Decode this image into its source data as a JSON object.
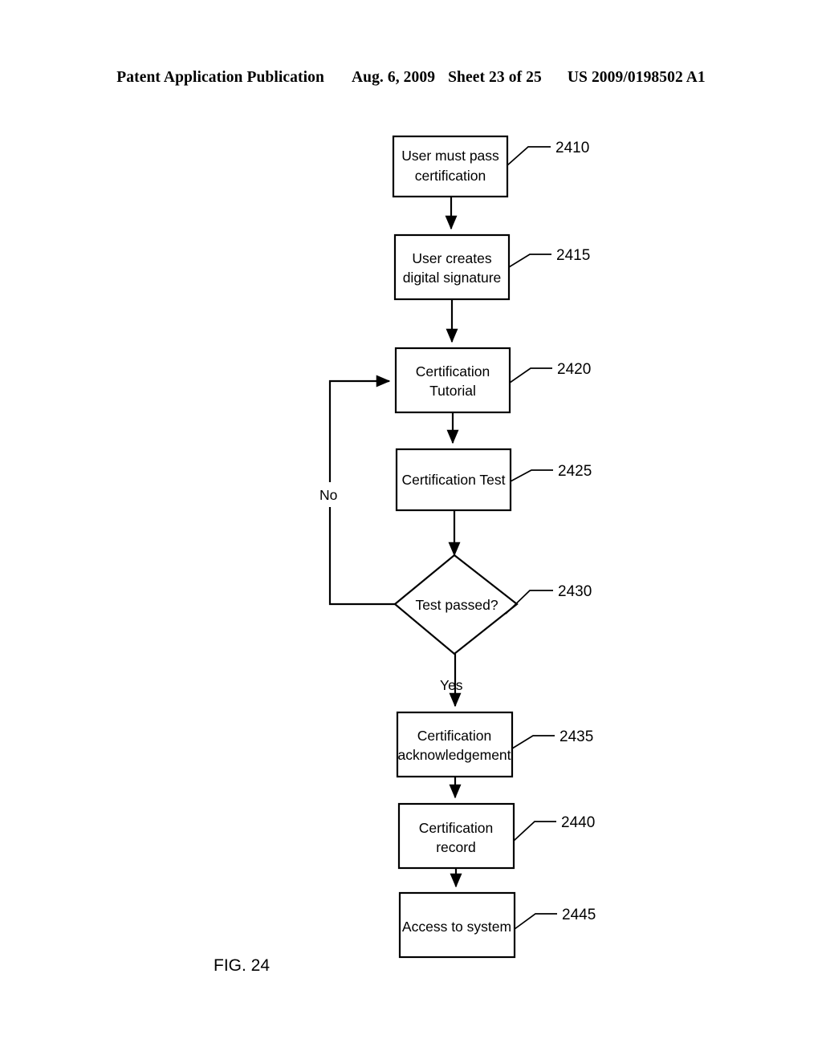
{
  "header": {
    "publication": "Patent Application Publication",
    "date": "Aug. 6, 2009",
    "sheet": "Sheet 23 of 25",
    "patent_number": "US 2009/0198502 A1"
  },
  "figure": {
    "caption": "FIG. 24",
    "nodes": [
      {
        "id": "2410",
        "label_line1": "User must pass",
        "label_line2": "certification",
        "ref": "2410",
        "shape": "rect"
      },
      {
        "id": "2415",
        "label_line1": "User creates",
        "label_line2": "digital signature",
        "ref": "2415",
        "shape": "rect"
      },
      {
        "id": "2420",
        "label_line1": "Certification",
        "label_line2": "Tutorial",
        "ref": "2420",
        "shape": "rect"
      },
      {
        "id": "2425",
        "label_line1": "Certification Test",
        "label_line2": "",
        "ref": "2425",
        "shape": "rect"
      },
      {
        "id": "2430",
        "label_line1": "Test passed?",
        "label_line2": "",
        "ref": "2430",
        "shape": "diamond"
      },
      {
        "id": "2435",
        "label_line1": "Certification",
        "label_line2": "acknowledgement",
        "ref": "2435",
        "shape": "rect"
      },
      {
        "id": "2440",
        "label_line1": "Certification",
        "label_line2": "record",
        "ref": "2440",
        "shape": "rect"
      },
      {
        "id": "2445",
        "label_line1": "Access to system",
        "label_line2": "",
        "ref": "2445",
        "shape": "rect"
      }
    ],
    "branch_labels": {
      "no": "No",
      "yes": "Yes"
    }
  }
}
